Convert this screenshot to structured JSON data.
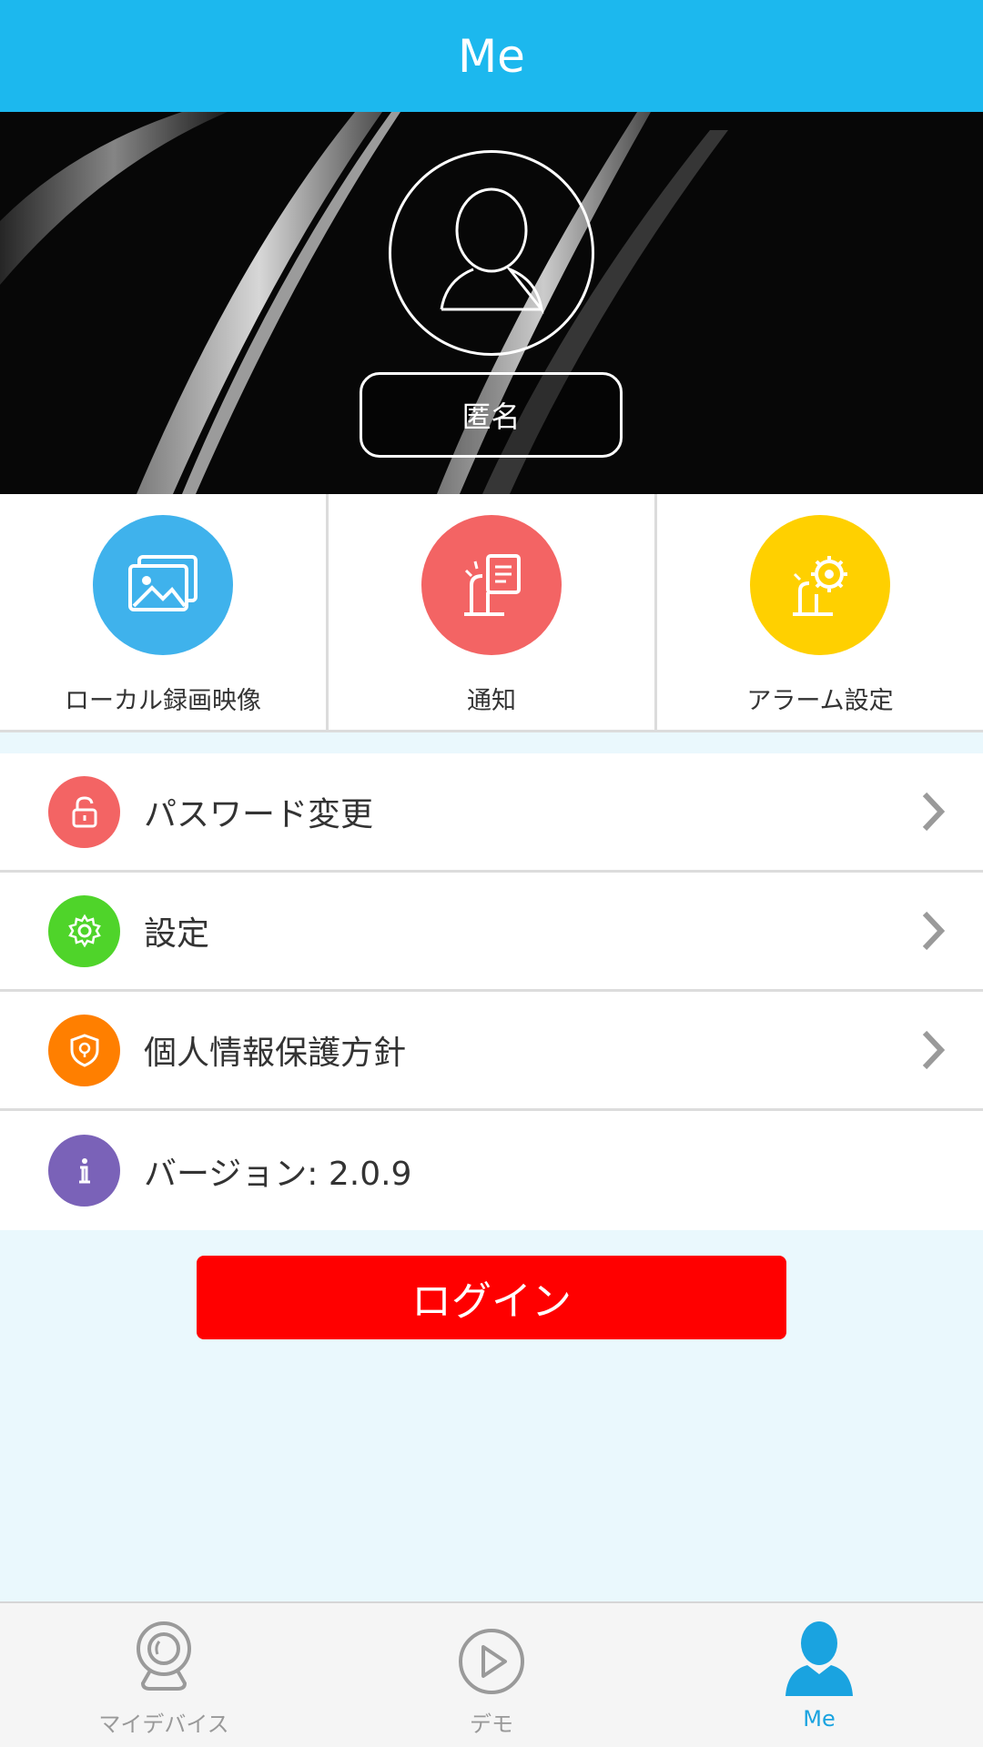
{
  "header": {
    "title": "Me"
  },
  "profile": {
    "name": "匿名"
  },
  "quick_actions": [
    {
      "label": "ローカル録画映像",
      "icon": "gallery-icon",
      "color": "#3fb2ec"
    },
    {
      "label": "通知",
      "icon": "notification-icon",
      "color": "#f36464"
    },
    {
      "label": "アラーム設定",
      "icon": "alarm-settings-icon",
      "color": "#ffd000"
    }
  ],
  "menu": [
    {
      "label": "パスワード変更",
      "icon": "lock-icon",
      "color": "#f36464",
      "chevron": true
    },
    {
      "label": "設定",
      "icon": "gear-icon",
      "color": "#4fd42a",
      "chevron": true
    },
    {
      "label": "個人情報保護方針",
      "icon": "shield-icon",
      "color": "#ff7f00",
      "chevron": true
    },
    {
      "label": "バージョン: 2.0.9",
      "icon": "info-icon",
      "color": "#7a62b8",
      "chevron": false
    }
  ],
  "login": {
    "label": "ログイン",
    "color": "#ff0000"
  },
  "bottom_nav": [
    {
      "label": "マイデバイス",
      "icon": "camera-device-icon",
      "active": false
    },
    {
      "label": "デモ",
      "icon": "play-icon",
      "active": false
    },
    {
      "label": "Me",
      "icon": "person-icon",
      "active": true
    }
  ],
  "colors": {
    "header": "#1cb8ee",
    "accent": "#1aa3e0",
    "background": "#eaf8fd"
  }
}
